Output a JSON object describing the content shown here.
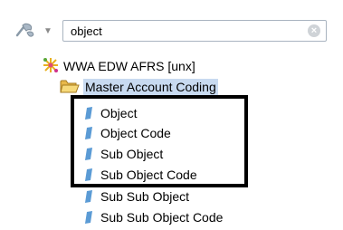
{
  "search": {
    "value": "object",
    "filter_icon": "magic-wand-filter-icon",
    "clear_icon": "clear-icon"
  },
  "tree": {
    "root_label": "WWA EDW AFRS [unx]",
    "root_icon": "universe-icon",
    "folder": {
      "label": "Master Account Coding",
      "icon": "open-folder-icon",
      "selected": true
    },
    "items": [
      {
        "label": "Object"
      },
      {
        "label": "Object Code"
      },
      {
        "label": "Sub Object"
      },
      {
        "label": "Sub Object Code"
      },
      {
        "label": "Sub Sub Object"
      },
      {
        "label": "Sub Sub Object Code"
      }
    ]
  },
  "colors": {
    "selection": "#c8daf0",
    "leaf_icon": "#5b9bd5",
    "folder": "#e8b84a",
    "highlight_border": "#000000"
  }
}
